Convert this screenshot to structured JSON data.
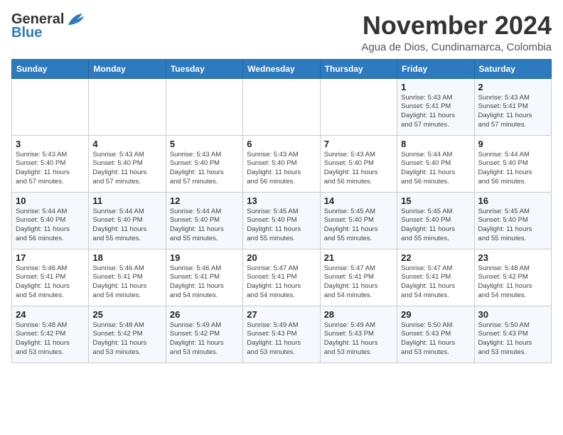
{
  "header": {
    "logo_general": "General",
    "logo_blue": "Blue",
    "month_title": "November 2024",
    "location": "Agua de Dios, Cundinamarca, Colombia"
  },
  "weekdays": [
    "Sunday",
    "Monday",
    "Tuesday",
    "Wednesday",
    "Thursday",
    "Friday",
    "Saturday"
  ],
  "weeks": [
    [
      {
        "day": "",
        "info": ""
      },
      {
        "day": "",
        "info": ""
      },
      {
        "day": "",
        "info": ""
      },
      {
        "day": "",
        "info": ""
      },
      {
        "day": "",
        "info": ""
      },
      {
        "day": "1",
        "info": "Sunrise: 5:43 AM\nSunset: 5:41 PM\nDaylight: 11 hours\nand 57 minutes."
      },
      {
        "day": "2",
        "info": "Sunrise: 5:43 AM\nSunset: 5:41 PM\nDaylight: 11 hours\nand 57 minutes."
      }
    ],
    [
      {
        "day": "3",
        "info": "Sunrise: 5:43 AM\nSunset: 5:40 PM\nDaylight: 11 hours\nand 57 minutes."
      },
      {
        "day": "4",
        "info": "Sunrise: 5:43 AM\nSunset: 5:40 PM\nDaylight: 11 hours\nand 57 minutes."
      },
      {
        "day": "5",
        "info": "Sunrise: 5:43 AM\nSunset: 5:40 PM\nDaylight: 11 hours\nand 57 minutes."
      },
      {
        "day": "6",
        "info": "Sunrise: 5:43 AM\nSunset: 5:40 PM\nDaylight: 11 hours\nand 56 minutes."
      },
      {
        "day": "7",
        "info": "Sunrise: 5:43 AM\nSunset: 5:40 PM\nDaylight: 11 hours\nand 56 minutes."
      },
      {
        "day": "8",
        "info": "Sunrise: 5:44 AM\nSunset: 5:40 PM\nDaylight: 11 hours\nand 56 minutes."
      },
      {
        "day": "9",
        "info": "Sunrise: 5:44 AM\nSunset: 5:40 PM\nDaylight: 11 hours\nand 56 minutes."
      }
    ],
    [
      {
        "day": "10",
        "info": "Sunrise: 5:44 AM\nSunset: 5:40 PM\nDaylight: 11 hours\nand 56 minutes."
      },
      {
        "day": "11",
        "info": "Sunrise: 5:44 AM\nSunset: 5:40 PM\nDaylight: 11 hours\nand 55 minutes."
      },
      {
        "day": "12",
        "info": "Sunrise: 5:44 AM\nSunset: 5:40 PM\nDaylight: 11 hours\nand 55 minutes."
      },
      {
        "day": "13",
        "info": "Sunrise: 5:45 AM\nSunset: 5:40 PM\nDaylight: 11 hours\nand 55 minutes."
      },
      {
        "day": "14",
        "info": "Sunrise: 5:45 AM\nSunset: 5:40 PM\nDaylight: 11 hours\nand 55 minutes."
      },
      {
        "day": "15",
        "info": "Sunrise: 5:45 AM\nSunset: 5:40 PM\nDaylight: 11 hours\nand 55 minutes."
      },
      {
        "day": "16",
        "info": "Sunrise: 5:45 AM\nSunset: 5:40 PM\nDaylight: 11 hours\nand 55 minutes."
      }
    ],
    [
      {
        "day": "17",
        "info": "Sunrise: 5:46 AM\nSunset: 5:41 PM\nDaylight: 11 hours\nand 54 minutes."
      },
      {
        "day": "18",
        "info": "Sunrise: 5:46 AM\nSunset: 5:41 PM\nDaylight: 11 hours\nand 54 minutes."
      },
      {
        "day": "19",
        "info": "Sunrise: 5:46 AM\nSunset: 5:41 PM\nDaylight: 11 hours\nand 54 minutes."
      },
      {
        "day": "20",
        "info": "Sunrise: 5:47 AM\nSunset: 5:41 PM\nDaylight: 11 hours\nand 54 minutes."
      },
      {
        "day": "21",
        "info": "Sunrise: 5:47 AM\nSunset: 5:41 PM\nDaylight: 11 hours\nand 54 minutes."
      },
      {
        "day": "22",
        "info": "Sunrise: 5:47 AM\nSunset: 5:41 PM\nDaylight: 11 hours\nand 54 minutes."
      },
      {
        "day": "23",
        "info": "Sunrise: 5:48 AM\nSunset: 5:42 PM\nDaylight: 11 hours\nand 54 minutes."
      }
    ],
    [
      {
        "day": "24",
        "info": "Sunrise: 5:48 AM\nSunset: 5:42 PM\nDaylight: 11 hours\nand 53 minutes."
      },
      {
        "day": "25",
        "info": "Sunrise: 5:48 AM\nSunset: 5:42 PM\nDaylight: 11 hours\nand 53 minutes."
      },
      {
        "day": "26",
        "info": "Sunrise: 5:49 AM\nSunset: 5:42 PM\nDaylight: 11 hours\nand 53 minutes."
      },
      {
        "day": "27",
        "info": "Sunrise: 5:49 AM\nSunset: 5:43 PM\nDaylight: 11 hours\nand 53 minutes."
      },
      {
        "day": "28",
        "info": "Sunrise: 5:49 AM\nSunset: 5:43 PM\nDaylight: 11 hours\nand 53 minutes."
      },
      {
        "day": "29",
        "info": "Sunrise: 5:50 AM\nSunset: 5:43 PM\nDaylight: 11 hours\nand 53 minutes."
      },
      {
        "day": "30",
        "info": "Sunrise: 5:50 AM\nSunset: 5:43 PM\nDaylight: 11 hours\nand 53 minutes."
      }
    ]
  ]
}
